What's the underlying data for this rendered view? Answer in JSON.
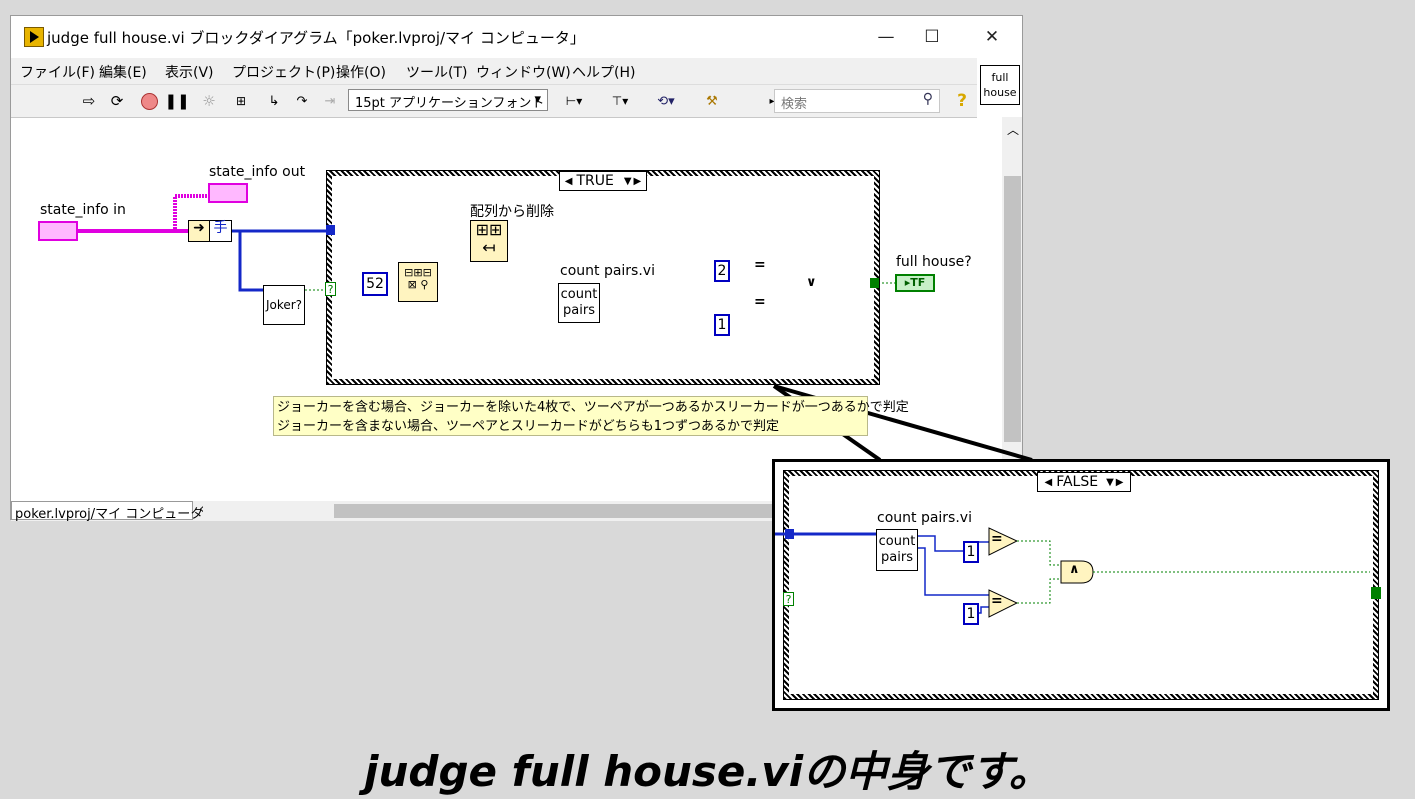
{
  "window": {
    "title": "judge full house.vi ブロックダイアグラム「poker.lvproj/マイ コンピュータ」",
    "minimize": "—",
    "maximize": "☐",
    "close": "✕"
  },
  "menu": {
    "items": [
      "ファイル(F)",
      "編集(E)",
      "表示(V)",
      "プロジェクト(P)",
      "操作(O)",
      "ツール(T)",
      "ウィンドウ(W)",
      "ヘルプ(H)"
    ]
  },
  "toolbar": {
    "font": "15pt アプリケーションフォント",
    "search_placeholder": "検索",
    "icons": [
      "run-arrow-icon",
      "run-continuous-icon",
      "abort-icon",
      "pause-icon",
      "highlight-bulb-icon",
      "retain-wire-icon",
      "step-into-icon",
      "step-over-icon",
      "step-out-icon",
      "align-icon",
      "distribute-icon",
      "reorder-icon",
      "cleanup-icon",
      "help-icon"
    ]
  },
  "vi_icon": "full house",
  "diagram": {
    "state_in": "state_info in",
    "state_out": "state_info out",
    "hand_label": "手",
    "joker_node": "Joker?",
    "case_true": "TRUE",
    "delete_label": "配列から削除",
    "const_52": "52",
    "count_pairs_label": "count pairs.vi",
    "count_pairs_node": "count pairs",
    "const_2": "2",
    "const_1": "1",
    "eq": "=",
    "or": "∨",
    "question": "?",
    "output_label": "full house?",
    "output_tf": "▸TF",
    "comment_line1": "ジョーカーを含む場合、ジョーカーを除いた4枚で、ツーペアが一つあるかスリーカードが一つあるかで判定",
    "comment_line2": "ジョーカーを含まない場合、ツーペアとスリーカードがどちらも1つずつあるかで判定"
  },
  "project_tab": "poker.lvproj/マイ コンピュータ",
  "zoom": {
    "case_false": "FALSE",
    "count_pairs_label": "count pairs.vi",
    "count_pairs_node": "count pairs",
    "const_1a": "1",
    "const_1b": "1",
    "eq": "=",
    "and": "∧",
    "question": "?"
  },
  "caption": "judge full house.viの中身です。"
}
